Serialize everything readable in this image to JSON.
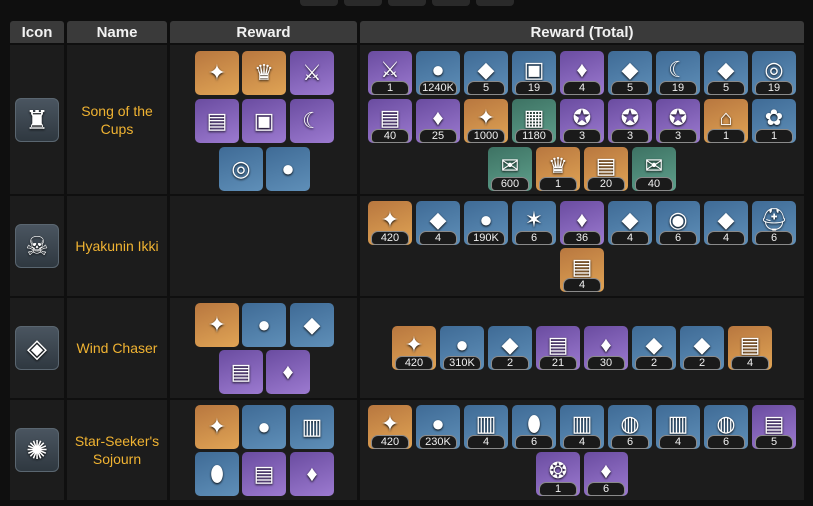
{
  "headers": {
    "icon": "Icon",
    "name": "Name",
    "reward": "Reward",
    "total": "Reward (Total)"
  },
  "rows": [
    {
      "name": "Song of the Cups",
      "icon": "cup-event-icon",
      "rewards": [
        {
          "icon": "primogem-icon",
          "rarity": 5
        },
        {
          "icon": "crown-icon",
          "rarity": 5
        },
        {
          "icon": "polearm-icon",
          "rarity": 4
        },
        {
          "icon": "book-icon",
          "rarity": 4
        },
        {
          "icon": "chest-icon",
          "rarity": 4
        },
        {
          "icon": "claw-icon",
          "rarity": 4
        },
        {
          "icon": "ring-icon",
          "rarity": 3
        },
        {
          "icon": "mora-icon",
          "rarity": 3
        }
      ],
      "totals": [
        {
          "icon": "polearm-icon",
          "rarity": 4,
          "count": "1"
        },
        {
          "icon": "mora-icon",
          "rarity": 3,
          "count": "1240K"
        },
        {
          "icon": "ore-icon",
          "rarity": 3,
          "count": "5"
        },
        {
          "icon": "chest-icon",
          "rarity": 3,
          "count": "19"
        },
        {
          "icon": "crystal-icon",
          "rarity": 4,
          "count": "4"
        },
        {
          "icon": "ore-icon",
          "rarity": 3,
          "count": "5"
        },
        {
          "icon": "claw-icon",
          "rarity": 3,
          "count": "19"
        },
        {
          "icon": "ore-icon",
          "rarity": 3,
          "count": "5"
        },
        {
          "icon": "ring-icon",
          "rarity": 3,
          "count": "19"
        },
        {
          "icon": "book-icon",
          "rarity": 4,
          "count": "40"
        },
        {
          "icon": "crystal-icon",
          "rarity": 4,
          "count": "25"
        },
        {
          "icon": "primogem-icon",
          "rarity": 5,
          "count": "1000"
        },
        {
          "icon": "artifact-icon",
          "rarity": 2,
          "count": "1180"
        },
        {
          "icon": "gold-icon",
          "rarity": 4,
          "count": "3"
        },
        {
          "icon": "gold-icon",
          "rarity": 4,
          "count": "3"
        },
        {
          "icon": "gold-icon",
          "rarity": 4,
          "count": "3"
        },
        {
          "icon": "furniture-icon",
          "rarity": 5,
          "count": "1"
        },
        {
          "icon": "coral-icon",
          "rarity": 3,
          "count": "1"
        },
        {
          "icon": "letter-icon",
          "rarity": 2,
          "count": "600"
        },
        {
          "icon": "crown-icon",
          "rarity": 5,
          "count": "1"
        },
        {
          "icon": "book-icon",
          "rarity": 5,
          "count": "20"
        },
        {
          "icon": "letter-icon",
          "rarity": 2,
          "count": "40"
        }
      ]
    },
    {
      "name": "Hyakunin Ikki",
      "icon": "oni-mask-event-icon",
      "rewards": [],
      "totals": [
        {
          "icon": "primogem-icon",
          "rarity": 5,
          "count": "420"
        },
        {
          "icon": "ore-icon",
          "rarity": 3,
          "count": "4"
        },
        {
          "icon": "mora-icon",
          "rarity": 3,
          "count": "190K"
        },
        {
          "icon": "branch-icon",
          "rarity": 3,
          "count": "6"
        },
        {
          "icon": "crystal-icon",
          "rarity": 4,
          "count": "36"
        },
        {
          "icon": "ore-icon",
          "rarity": 3,
          "count": "4"
        },
        {
          "icon": "shell-icon",
          "rarity": 3,
          "count": "6"
        },
        {
          "icon": "ore-icon",
          "rarity": 3,
          "count": "4"
        },
        {
          "icon": "helmet-icon",
          "rarity": 3,
          "count": "6"
        },
        {
          "icon": "book-icon",
          "rarity": 5,
          "count": "4"
        }
      ]
    },
    {
      "name": "Wind Chaser",
      "icon": "wind-event-icon",
      "rewards": [
        {
          "icon": "primogem-icon",
          "rarity": 5
        },
        {
          "icon": "mora-icon",
          "rarity": 3
        },
        {
          "icon": "ore-icon",
          "rarity": 3
        },
        {
          "icon": "book-icon",
          "rarity": 4
        },
        {
          "icon": "crystal-icon",
          "rarity": 4
        }
      ],
      "totals": [
        {
          "icon": "primogem-icon",
          "rarity": 5,
          "count": "420"
        },
        {
          "icon": "mora-icon",
          "rarity": 3,
          "count": "310K"
        },
        {
          "icon": "ore-icon",
          "rarity": 3,
          "count": "2"
        },
        {
          "icon": "book-icon",
          "rarity": 4,
          "count": "21"
        },
        {
          "icon": "crystal-icon",
          "rarity": 4,
          "count": "30"
        },
        {
          "icon": "ore-icon",
          "rarity": 3,
          "count": "2"
        },
        {
          "icon": "ore-icon",
          "rarity": 3,
          "count": "2"
        },
        {
          "icon": "book-icon",
          "rarity": 5,
          "count": "4"
        }
      ]
    },
    {
      "name": "Star-Seeker's Sojourn",
      "icon": "star-event-icon",
      "rewards": [
        {
          "icon": "primogem-icon",
          "rarity": 5
        },
        {
          "icon": "mora-icon",
          "rarity": 3
        },
        {
          "icon": "tablet-icon",
          "rarity": 3
        },
        {
          "icon": "pendant-icon",
          "rarity": 3
        },
        {
          "icon": "book-icon",
          "rarity": 4
        },
        {
          "icon": "crystal-icon",
          "rarity": 4
        }
      ],
      "totals": [
        {
          "icon": "primogem-icon",
          "rarity": 5,
          "count": "420"
        },
        {
          "icon": "mora-icon",
          "rarity": 3,
          "count": "230K"
        },
        {
          "icon": "tablet-icon",
          "rarity": 3,
          "count": "4"
        },
        {
          "icon": "pendant-icon",
          "rarity": 3,
          "count": "6"
        },
        {
          "icon": "tablet-icon",
          "rarity": 3,
          "count": "4"
        },
        {
          "icon": "disc-icon",
          "rarity": 3,
          "count": "6"
        },
        {
          "icon": "tablet-icon",
          "rarity": 3,
          "count": "4"
        },
        {
          "icon": "disc-icon",
          "rarity": 3,
          "count": "6"
        },
        {
          "icon": "book-icon",
          "rarity": 4,
          "count": "5"
        },
        {
          "icon": "orb-icon",
          "rarity": 4,
          "count": "1"
        },
        {
          "icon": "crystal-icon",
          "rarity": 4,
          "count": "6"
        }
      ]
    }
  ],
  "glyphs": {
    "primogem-icon": "✦",
    "crown-icon": "♛",
    "polearm-icon": "⚔",
    "book-icon": "▤",
    "chest-icon": "▣",
    "claw-icon": "☾",
    "ring-icon": "◎",
    "mora-icon": "●",
    "ore-icon": "◆",
    "crystal-icon": "♦",
    "artifact-icon": "▦",
    "gold-icon": "✪",
    "furniture-icon": "⌂",
    "coral-icon": "✿",
    "letter-icon": "✉",
    "branch-icon": "✶",
    "shell-icon": "◉",
    "helmet-icon": "⛑",
    "tablet-icon": "▥",
    "pendant-icon": "⬮",
    "disc-icon": "◍",
    "orb-icon": "❂",
    "cup-event-icon": "♜",
    "oni-mask-event-icon": "☠",
    "wind-event-icon": "◈",
    "star-event-icon": "✺"
  }
}
